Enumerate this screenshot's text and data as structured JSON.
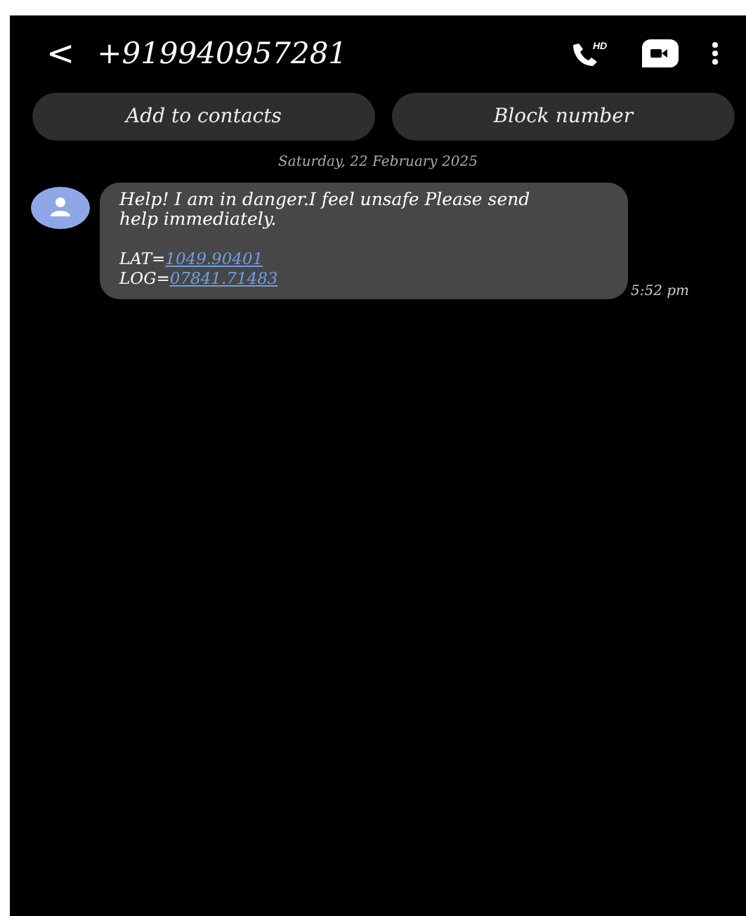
{
  "header": {
    "back": "<",
    "title": "+919940957281",
    "call_badge": "HD"
  },
  "actions": [
    "Add to contacts",
    "Block number"
  ],
  "date": "Saturday, 22 February 2025",
  "message": {
    "text": "Help! I am in danger.I feel unsafe Please send help immediately.",
    "coords": [
      {
        "label": "LAT=",
        "link": "1049.90401"
      },
      {
        "label": "LOG=",
        "link": "07841.71483"
      }
    ],
    "time": "5:52 pm"
  }
}
